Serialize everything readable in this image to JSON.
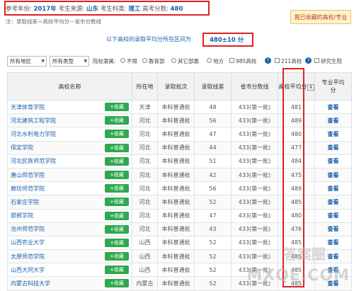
{
  "criteria": {
    "prefix": "参考年份:",
    "year": "2017年",
    "source_label": "考生来源:",
    "source": "山东",
    "subject_label": "考生科类:",
    "subject": "理工",
    "score_label": "高考分数:",
    "score": "480"
  },
  "note": "注：录取线差＝高校平均分－省市分数线",
  "favorites_button": "我已收藏的高校/专业",
  "info": {
    "text": "以下高校的录取平均分所在区间为",
    "range": "480±10 分"
  },
  "filters": {
    "region": "所有地区",
    "type": "所有类型",
    "affiliation_label": "院校隶属:",
    "radios": [
      "不限",
      "教育部",
      "其它部委",
      "地方"
    ],
    "checks": [
      "985高校",
      "211高校",
      "研究生院"
    ]
  },
  "table": {
    "headers": [
      "高校名称",
      "所在地",
      "录取批次",
      "录取线差",
      "省市分数线",
      "高校平均分",
      "专业平均分"
    ],
    "fav_label": "+收藏",
    "rows": [
      {
        "name": "天津体育学院",
        "loc": "天津",
        "batch": "本科普通批",
        "diff": "48",
        "line": "433(第一批)",
        "avg": "481",
        "major": "查看"
      },
      {
        "name": "河北建筑工程学院",
        "loc": "河北",
        "batch": "本科普通批",
        "diff": "56",
        "line": "433(第一批)",
        "avg": "489",
        "major": "查看"
      },
      {
        "name": "河北水利电力学院",
        "loc": "河北",
        "batch": "本科普通批",
        "diff": "47",
        "line": "433(第一批)",
        "avg": "480",
        "major": "查看"
      },
      {
        "name": "保定学院",
        "loc": "河北",
        "batch": "本科普通批",
        "diff": "44",
        "line": "433(第一批)",
        "avg": "477",
        "major": "查看"
      },
      {
        "name": "河北民族师范学院",
        "loc": "河北",
        "batch": "本科普通批",
        "diff": "51",
        "line": "433(第一批)",
        "avg": "484",
        "major": "查看"
      },
      {
        "name": "唐山师范学院",
        "loc": "河北",
        "batch": "本科普通批",
        "diff": "42",
        "line": "433(第一批)",
        "avg": "475",
        "major": "查看"
      },
      {
        "name": "廊坊师范学院",
        "loc": "河北",
        "batch": "本科普通批",
        "diff": "56",
        "line": "433(第一批)",
        "avg": "489",
        "major": "查看"
      },
      {
        "name": "石家庄学院",
        "loc": "河北",
        "batch": "本科普通批",
        "diff": "52",
        "line": "433(第一批)",
        "avg": "485",
        "major": "查看"
      },
      {
        "name": "邯郸学院",
        "loc": "河北",
        "batch": "本科普通批",
        "diff": "47",
        "line": "433(第一批)",
        "avg": "480",
        "major": "查看"
      },
      {
        "name": "沧州师范学院",
        "loc": "河北",
        "batch": "本科普通批",
        "diff": "43",
        "line": "433(第一批)",
        "avg": "476",
        "major": "查看"
      },
      {
        "name": "山西农业大学",
        "loc": "山西",
        "batch": "本科普通批",
        "diff": "52",
        "line": "433(第一批)",
        "avg": "485",
        "major": "查看"
      },
      {
        "name": "太原师范学院",
        "loc": "山西",
        "batch": "本科普通批",
        "diff": "52",
        "line": "433(第一批)",
        "avg": "485",
        "major": "查看"
      },
      {
        "name": "山西大同大学",
        "loc": "山西",
        "batch": "本科普通批",
        "diff": "52",
        "line": "433(第一批)",
        "avg": "485",
        "major": "查看"
      },
      {
        "name": "内蒙古科技大学",
        "loc": "内蒙古",
        "batch": "本科普通批",
        "diff": "52",
        "line": "433(第一批)",
        "avg": "485",
        "major": "查看"
      }
    ]
  },
  "watermark": {
    "line1": "答案圈",
    "line2": "MXQE.COM"
  }
}
